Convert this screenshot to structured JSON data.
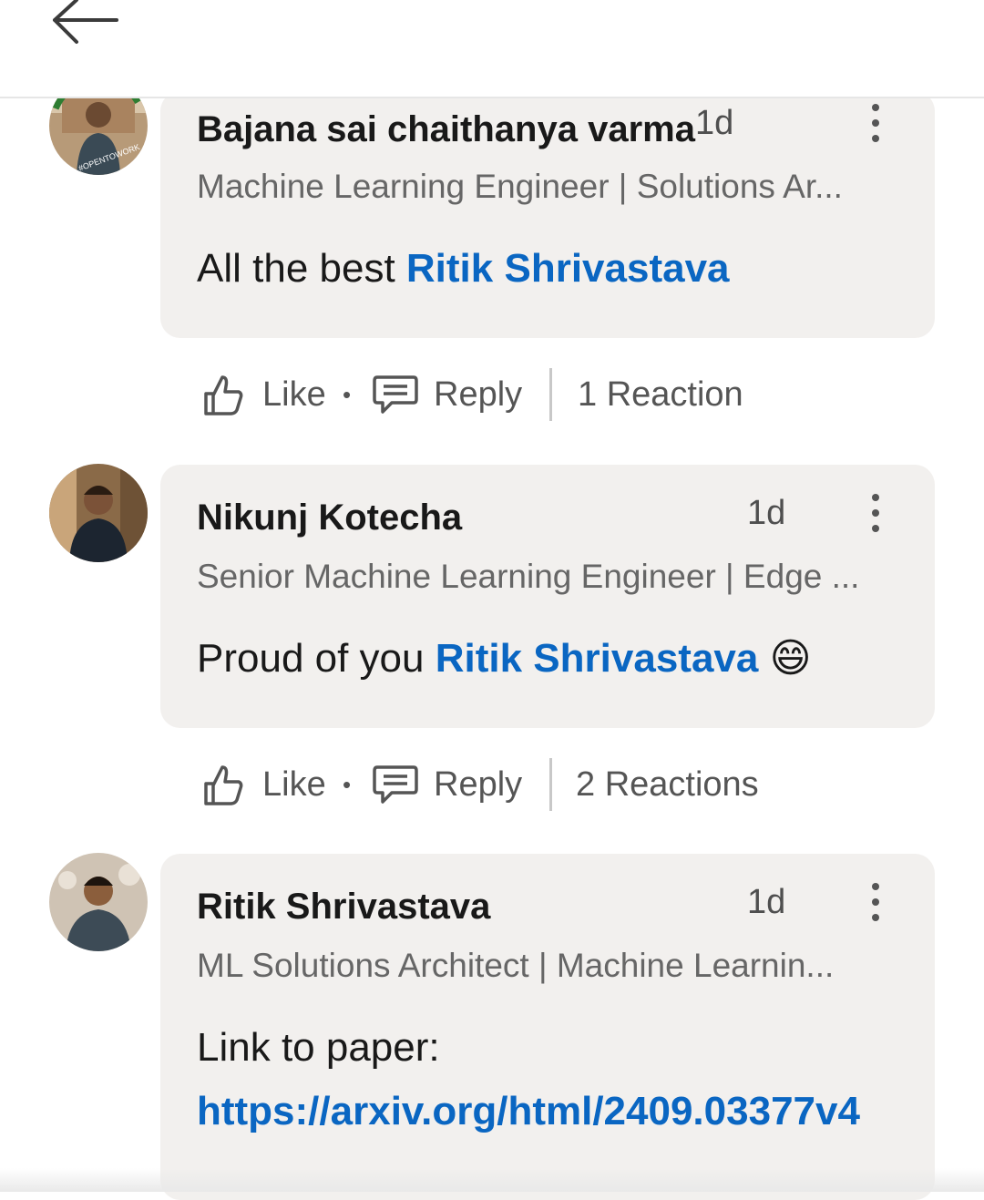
{
  "header": {
    "back_icon": "arrow-left-icon"
  },
  "comments": [
    {
      "author": "Bajana sai chaithanya varma",
      "time": "1d",
      "headline": "Machine Learning Engineer | Solutions Ar...",
      "text_prefix": "All the best ",
      "mention": "Ritik Shrivastava",
      "badge": "#OPENTOWORK",
      "actions": {
        "like": "Like",
        "reply": "Reply",
        "reactions": "1 Reaction"
      }
    },
    {
      "author": "Nikunj Kotecha",
      "time": "1d",
      "headline": "Senior Machine Learning Engineer | Edge ...",
      "text_prefix": "Proud of you ",
      "mention": "Ritik Shrivastava",
      "emoji": "😄",
      "actions": {
        "like": "Like",
        "reply": "Reply",
        "reactions": "2 Reactions"
      }
    },
    {
      "author": "Ritik Shrivastava",
      "time": "1d",
      "headline": "ML Solutions Architect | Machine Learnin...",
      "text_prefix": "Link to paper:",
      "link": "https://arxiv.org/html/2409.03377v4"
    }
  ],
  "colors": {
    "link": "#0a66c2",
    "bubble": "#f2f0ee",
    "opentowork": "#2e7d32"
  }
}
